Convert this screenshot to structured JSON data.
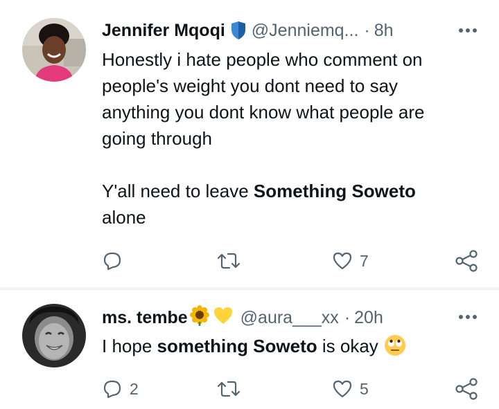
{
  "tweets": [
    {
      "display_name": "Jennifer Mqoqi",
      "handle": "@Jenniemq...",
      "separator": "·",
      "time": "8h",
      "text_lines": [
        "Honestly i hate people who comment on",
        "people's weight you dont need to say",
        "anything  you dont know what people are",
        "going through"
      ],
      "text2_prefix": "Y'all need to leave ",
      "text2_bold": "Something Soweto",
      "text2_suffix": "alone",
      "reply_count": "",
      "retweet_count": "",
      "like_count": "7",
      "badge_icon": "blue-shield-icon",
      "colors": {
        "badge": "#3b88d6",
        "badge_dark": "#1d5fa3"
      }
    },
    {
      "display_name": "ms. tembe",
      "name_emoji": [
        "sunflower",
        "yellow-heart"
      ],
      "handle": "@aura___xx",
      "separator": "·",
      "time": "20h",
      "text_prefix": "I hope ",
      "text_bold": "something Soweto",
      "text_suffix": " is okay",
      "text_emoji": "face-with-rolling-eyes",
      "reply_count": "2",
      "retweet_count": "",
      "like_count": "5"
    }
  ],
  "colors": {
    "text_primary": "#0f1419",
    "text_secondary": "#536471",
    "divider": "#eff3f4"
  }
}
